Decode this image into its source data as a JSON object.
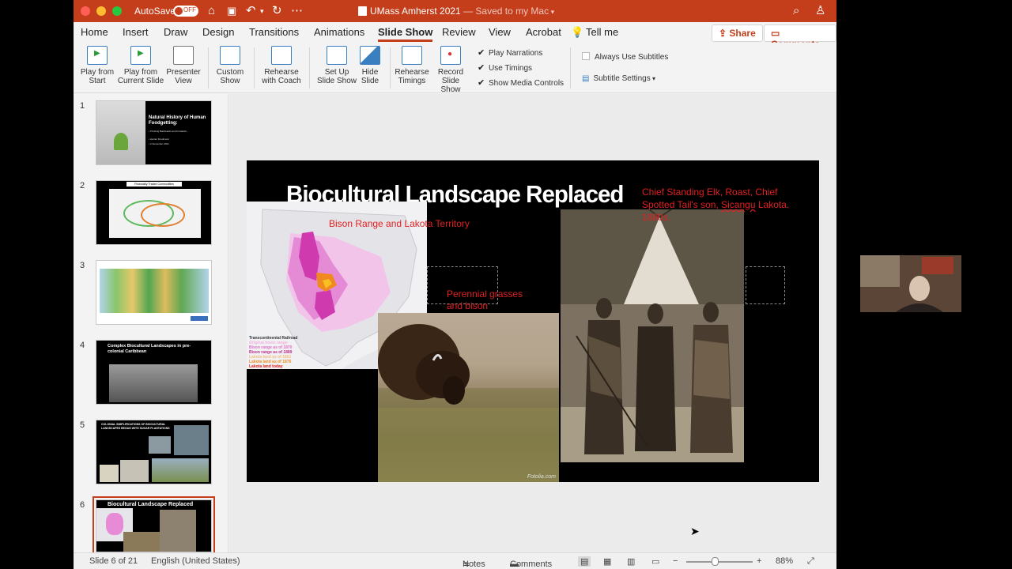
{
  "titlebar": {
    "autosave_label": "AutoSave",
    "autosave_state": "OFF",
    "document_title": "UMass Amherst 2021",
    "save_status": "— Saved to my Mac"
  },
  "tabs": [
    "Home",
    "Insert",
    "Draw",
    "Design",
    "Transitions",
    "Animations",
    "Slide Show",
    "Review",
    "View",
    "Acrobat"
  ],
  "tell_me": "Tell me",
  "share_label": "Share",
  "comments_label": "Comments",
  "ribbon": {
    "play_from_start": [
      "Play from",
      "Start"
    ],
    "play_from_current": [
      "Play from",
      "Current Slide"
    ],
    "presenter_view": [
      "Presenter",
      "View"
    ],
    "custom_show": [
      "Custom",
      "Show"
    ],
    "rehearse_coach": [
      "Rehearse",
      "with Coach"
    ],
    "set_up": [
      "Set Up",
      "Slide Show"
    ],
    "hide_slide": [
      "Hide",
      "Slide"
    ],
    "rehearse_timings": [
      "Rehearse",
      "Timings"
    ],
    "record_show": [
      "Record",
      "Slide Show"
    ],
    "play_narrations": "Play Narrations",
    "use_timings": "Use Timings",
    "show_media_controls": "Show Media Controls",
    "always_use_subtitles": "Always Use Subtitles",
    "subtitle_settings": "Subtitle Settings"
  },
  "thumbnails": {
    "numbers": [
      "1",
      "2",
      "3",
      "4",
      "5",
      "6"
    ],
    "slide1_title": "Natural History of Human Foodgetting:",
    "slide1_sub": "• Thinking Backwards and Forwards...",
    "slide1_author": "• Harriet Friedmann",
    "slide1_date": "• 2 November 2021",
    "slide2_title": "Financially Traded Commodities",
    "slide4_title": "Complex Biocultural Landscapes in pre-colonial Caribbean",
    "slide5_title": "COLONIAL SIMPLIFICATIONS OF BIOCULTURAL LANDSCAPES BEGAN WITH SUGAR PLANTATIONS",
    "slide6_title": "Biocultural Landscape Replaced"
  },
  "slide": {
    "title": "Biocultural Landscape Replaced",
    "map_label": "Bison Range and Lakota Territory",
    "grass_label": "Perennial grasses and bison",
    "caption_a": "Chief Standing Elk, Roast, Chief Spotted Tail's son, ",
    "caption_b": "Sicangu",
    "caption_c": " Lakota. 1880s.",
    "legend": [
      "Transcontinental Railroad",
      "Original bison range",
      "Bison range as of 1870",
      "Bison range as of 1889",
      "Lakota land as of 1851",
      "Lakota land as of 1876",
      "Lakota land today"
    ],
    "watermark": "Fotolia.com"
  },
  "status": {
    "slide_count": "Slide 6 of 21",
    "language": "English (United States)",
    "notes": "Notes",
    "comments": "Comments",
    "zoom": "88%"
  },
  "colors": {
    "accent": "#c43e1c",
    "caption_red": "#e02020"
  }
}
